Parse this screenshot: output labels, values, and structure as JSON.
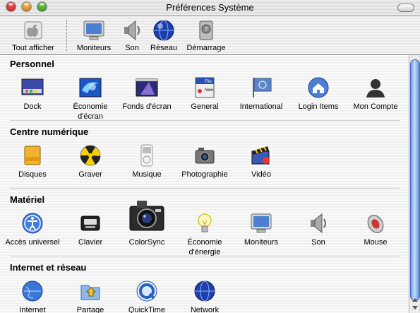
{
  "window": {
    "title": "Préférences Système"
  },
  "toolbar": {
    "items": [
      {
        "label": "Tout afficher",
        "icon": "apple-icon"
      },
      {
        "label": "Moniteurs",
        "icon": "monitor-icon"
      },
      {
        "label": "Son",
        "icon": "speaker-icon"
      },
      {
        "label": "Réseau",
        "icon": "globe-icon"
      },
      {
        "label": "Démarrage",
        "icon": "disk-icon"
      }
    ]
  },
  "sections": [
    {
      "title": "Personnel",
      "items": [
        {
          "label": "Dock",
          "icon": "dock-icon"
        },
        {
          "label": "Économie d'écran",
          "icon": "screensaver-icon"
        },
        {
          "label": "Fonds d'écran",
          "icon": "desktop-icon"
        },
        {
          "label": "General",
          "icon": "general-icon"
        },
        {
          "label": "International",
          "icon": "flag-icon"
        },
        {
          "label": "Login Items",
          "icon": "house-icon"
        },
        {
          "label": "Mon Compte",
          "icon": "user-icon"
        }
      ]
    },
    {
      "title": "Centre numérique",
      "items": [
        {
          "label": "Disques",
          "icon": "cd-icon"
        },
        {
          "label": "Graver",
          "icon": "burn-icon"
        },
        {
          "label": "Musique",
          "icon": "ipod-icon"
        },
        {
          "label": "Photographie",
          "icon": "camera-icon"
        },
        {
          "label": "Vidéo",
          "icon": "clapper-icon"
        }
      ]
    },
    {
      "title": "Matériel",
      "items": [
        {
          "label": "Accès universel",
          "icon": "accessibility-icon"
        },
        {
          "label": "Clavier",
          "icon": "keyboard-icon"
        },
        {
          "label": "ColorSync",
          "icon": "colorsync-icon"
        },
        {
          "label": "Économie d'énergie",
          "icon": "bulb-icon"
        },
        {
          "label": "Moniteurs",
          "icon": "monitor-icon"
        },
        {
          "label": "Son",
          "icon": "speaker-icon"
        },
        {
          "label": "Mouse",
          "icon": "mouse-icon"
        }
      ]
    },
    {
      "title": "Internet et réseau",
      "items": [
        {
          "label": "Internet",
          "icon": "globe-icon"
        },
        {
          "label": "Partage",
          "icon": "sharing-icon"
        },
        {
          "label": "QuickTime",
          "icon": "quicktime-icon"
        },
        {
          "label": "Network",
          "icon": "globe-icon"
        }
      ]
    }
  ]
}
